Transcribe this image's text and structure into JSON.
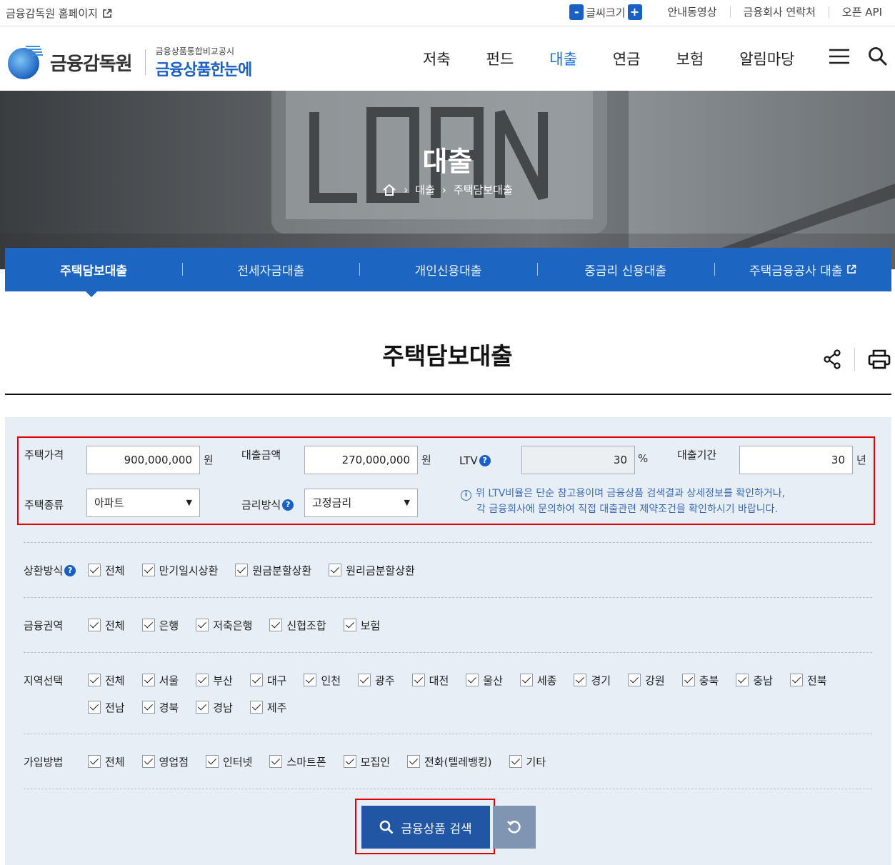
{
  "util": {
    "homepage": "금융감독원 홈페이지",
    "font_size": "글씨크기",
    "font_minus": "-",
    "font_plus": "+",
    "links": [
      "안내동영상",
      "금융회사 연락처",
      "오픈 API"
    ]
  },
  "header": {
    "logo_name": "금융감독원",
    "logo_sub1": "금융상품통합비교공시",
    "logo_sub2": "금융상품한눈에",
    "nav": [
      {
        "label": "저축",
        "active": false
      },
      {
        "label": "펀드",
        "active": false
      },
      {
        "label": "대출",
        "active": true
      },
      {
        "label": "연금",
        "active": false
      },
      {
        "label": "보험",
        "active": false
      },
      {
        "label": "알림마당",
        "active": false
      }
    ]
  },
  "hero": {
    "title": "대출",
    "breadcrumb": [
      "대출",
      "주택담보대출"
    ]
  },
  "tabs": [
    {
      "label": "주택담보대출",
      "active": true
    },
    {
      "label": "전세자금대출",
      "active": false
    },
    {
      "label": "개인신용대출",
      "active": false
    },
    {
      "label": "중금리 신용대출",
      "active": false
    },
    {
      "label": "주택금융공사 대출",
      "active": false,
      "external": true
    }
  ],
  "page_title": "주택담보대출",
  "form": {
    "house_price_label": "주택가격",
    "house_price_value": "900,000,000",
    "house_price_unit": "원",
    "loan_amount_label": "대출금액",
    "loan_amount_value": "270,000,000",
    "loan_amount_unit": "원",
    "ltv_label": "LTV",
    "ltv_value": "30",
    "ltv_unit": "%",
    "period_label": "대출기간",
    "period_value": "30",
    "period_unit": "년",
    "house_type_label": "주택종류",
    "house_type_value": "아파트",
    "rate_type_label": "금리방식",
    "rate_type_value": "고정금리",
    "note_line1": "위 LTV비율은 단순 참고용이며 금융상품 검색결과 상세정보를 확인하거나,",
    "note_line2": "각 금융회사에 문의하여 직접 대출관련 제약조건을 확인하시기 바랍니다."
  },
  "filters": {
    "repay": {
      "label": "상환방식",
      "options": [
        "전체",
        "만기일시상환",
        "원금분할상환",
        "원리금분할상환"
      ]
    },
    "sector": {
      "label": "금융권역",
      "options": [
        "전체",
        "은행",
        "저축은행",
        "신협조합",
        "보험"
      ]
    },
    "region": {
      "label": "지역선택",
      "options": [
        "전체",
        "서울",
        "부산",
        "대구",
        "인천",
        "광주",
        "대전",
        "울산",
        "세종",
        "경기",
        "강원",
        "충북",
        "충남",
        "전북",
        "전남",
        "경북",
        "경남",
        "제주"
      ]
    },
    "join": {
      "label": "가입방법",
      "options": [
        "전체",
        "영업점",
        "인터넷",
        "스마트폰",
        "모집인",
        "전화(텔레뱅킹)",
        "기타"
      ]
    }
  },
  "buttons": {
    "search": "금융상품 검색"
  },
  "colors": {
    "primary": "#1c65c0",
    "active_nav": "#1a6ed8",
    "panel_bg": "#e8eef6",
    "highlight": "#e30000"
  }
}
